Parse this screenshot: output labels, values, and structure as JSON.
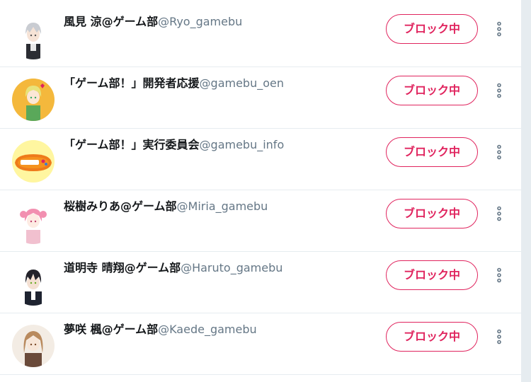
{
  "blocked_list": {
    "button_label": "ブロック中",
    "users": [
      {
        "display_name": "風見 涼@ゲーム部",
        "handle": "@Ryo_gamebu",
        "avatar": "avatar-ryo"
      },
      {
        "display_name": "「ゲーム部！」開発者応援",
        "handle": "@gamebu_oen",
        "avatar": "avatar-oen"
      },
      {
        "display_name": "「ゲーム部！」実行委員会",
        "handle": "@gamebu_info",
        "avatar": "avatar-info-logo"
      },
      {
        "display_name": "桜樹みりあ@ゲーム部",
        "handle": "@Miria_gamebu",
        "avatar": "avatar-miria"
      },
      {
        "display_name": "道明寺 晴翔@ゲーム部",
        "handle": "@Haruto_gamebu",
        "avatar": "avatar-haruto"
      },
      {
        "display_name": "夢咲 楓@ゲーム部",
        "handle": "@Kaede_gamebu",
        "avatar": "avatar-kaede"
      }
    ]
  },
  "colors": {
    "accent": "#e0245e",
    "name": "#14171a",
    "handle": "#657786",
    "divider": "#e6ecf0"
  }
}
